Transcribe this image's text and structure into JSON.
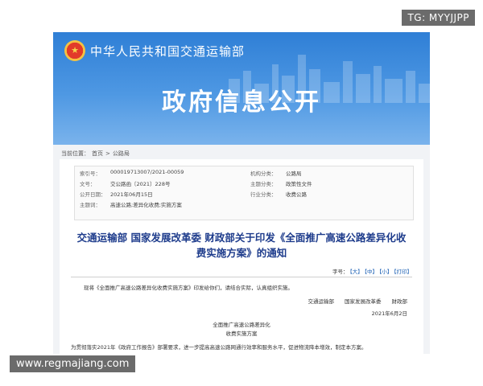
{
  "watermark_tg": "TG: MYYJJPP",
  "watermark_url": "www.regmajiang.com",
  "ministry": "中华人民共和国交通运输部",
  "banner_title": "政府信息公开",
  "breadcrumb": {
    "label": "当前位置：",
    "home": "首页",
    "sep": ">",
    "section": "公路局"
  },
  "meta": {
    "index_label": "索引号：",
    "index_value": "000019713007/2021-00059",
    "org_label": "机构分类：",
    "org_value": "公路局",
    "docno_label": "文号：",
    "docno_value": "交公路函〔2021〕228号",
    "topic_label": "主题分类：",
    "topic_value": "政策性文件",
    "date_label": "公开日期：",
    "date_value": "2021年06月15日",
    "industry_label": "行业分类：",
    "industry_value": "收费公路",
    "subject_label": "主题词：",
    "subject_value": "高速公路;差异化收费;实施方案"
  },
  "title_line1": "交通运输部 国家发展改革委 财政部关于印发《全面推广高速公路差异化收",
  "title_line2": "费实施方案》的通知",
  "fontsize": {
    "label": "字号：",
    "large": "【大】",
    "medium": "【中】",
    "small": "【小】",
    "print": "【打印】"
  },
  "body": {
    "intro": "现将《全面推广高速公路差异化收费实施方案》印发给你们，请结合实际，认真组织实施。",
    "signers": "交通运输部　　国家发展改革委　　财政部",
    "date": "2021年6月2日",
    "plan_title1": "全面推广高速公路差异化",
    "plan_title2": "收费实施方案",
    "plan_intro": "为贯彻落实2021年《政府工作报告》部署要求，进一步提高高速公路网通行效率和服务水平，促进物流降本增效，制定本方案。"
  },
  "colors": {
    "banner": "#2f7fd6",
    "title": "#1e3c8c",
    "link": "#1a5fb4"
  }
}
